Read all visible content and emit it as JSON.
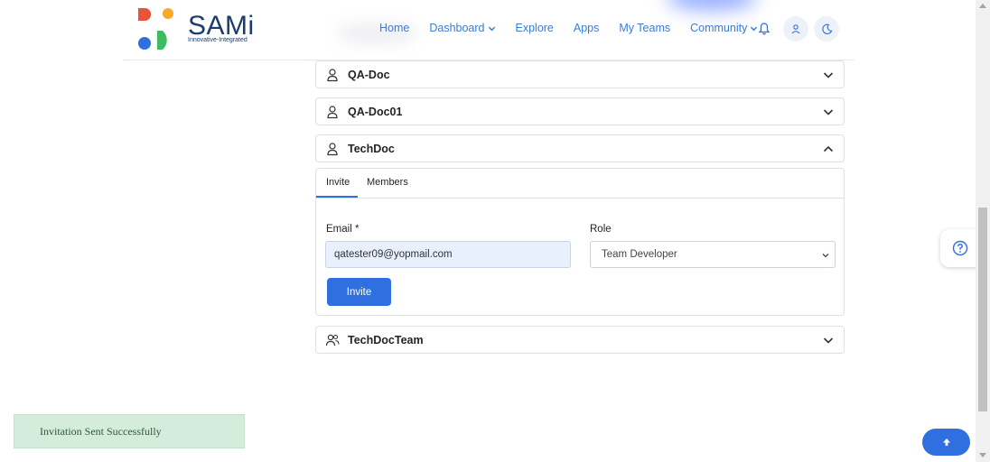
{
  "brand": {
    "name": "SAMi",
    "tagline": "Innovative-Integrated",
    "colors": {
      "red": "#e8533a",
      "orange": "#f7a928",
      "blue": "#2f6fe0",
      "green": "#3dbd5d",
      "navy": "#1a3c6e"
    }
  },
  "nav": {
    "items": [
      {
        "label": "Home",
        "has_dropdown": false
      },
      {
        "label": "Dashboard",
        "has_dropdown": true
      },
      {
        "label": "Explore",
        "has_dropdown": false
      },
      {
        "label": "Apps",
        "has_dropdown": false
      },
      {
        "label": "My Teams",
        "has_dropdown": false
      },
      {
        "label": "Community",
        "has_dropdown": true
      }
    ],
    "icons": [
      "bell-icon",
      "user-icon",
      "moon-icon"
    ]
  },
  "teams": [
    {
      "name": "QA-Doc",
      "icon": "user-icon",
      "expanded": false
    },
    {
      "name": "QA-Doc01",
      "icon": "user-icon",
      "expanded": false
    },
    {
      "name": "TechDoc",
      "icon": "user-icon",
      "expanded": true
    },
    {
      "name": "TechDocTeam",
      "icon": "users-icon",
      "expanded": false
    }
  ],
  "invite_panel": {
    "tabs": [
      "Invite",
      "Members"
    ],
    "active_tab": "Invite",
    "email_label": "Email *",
    "email_value": "qatester09@yopmail.com",
    "role_label": "Role",
    "role_value": "Team Developer",
    "invite_button": "Invite"
  },
  "toast": {
    "message": "Invitation Sent Successfully",
    "color": "#d4ecdb"
  },
  "help_icon": "question-circle-icon",
  "scroll_top_icon": "arrow-up-icon",
  "accent_color": "#2f6fe0"
}
